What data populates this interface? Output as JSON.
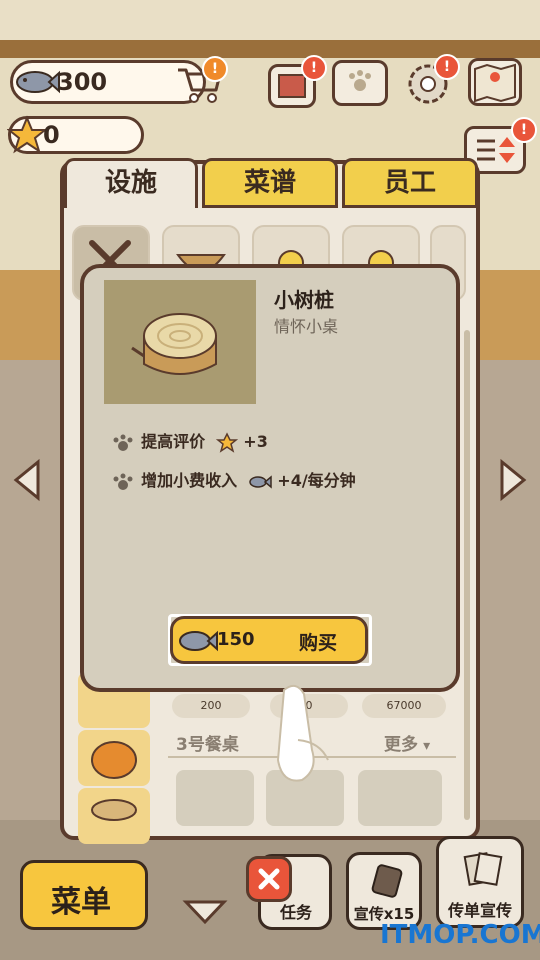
{
  "currency": {
    "fish": "300",
    "stars": "0"
  },
  "tabs": [
    {
      "label": "设施",
      "active": true
    },
    {
      "label": "菜谱",
      "active": false
    },
    {
      "label": "员工",
      "active": false
    }
  ],
  "item": {
    "title": "小树桩",
    "subtitle": "情怀小桌",
    "effects": [
      {
        "label": "提高评价",
        "value": "+3",
        "icon": "star-icon"
      },
      {
        "label": "增加小费收入",
        "value": "+4/每分钟",
        "icon": "fish-icon"
      }
    ],
    "price": "150",
    "buy_label": "购买"
  },
  "list": {
    "prices": [
      "200",
      "0",
      "67000"
    ],
    "section_title": "3号餐桌",
    "more_label": "更多"
  },
  "bottom": {
    "menu_label": "菜单",
    "task_label": "任务",
    "promo_label": "宣传x15",
    "flyer_label": "传单宣传"
  },
  "watermark": "ITMOP.COM",
  "colors": {
    "accent": "#f7c63e",
    "outline": "#5a3b2c",
    "badge": "#e9553a",
    "watermark": "#1976d2"
  }
}
